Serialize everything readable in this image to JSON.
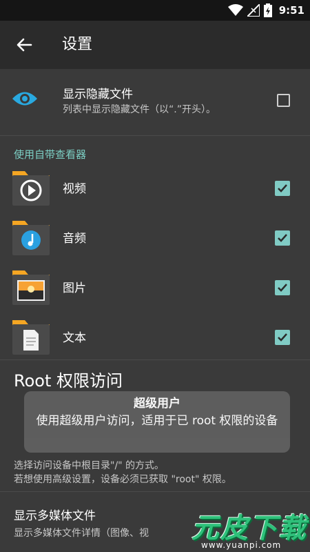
{
  "status_bar": {
    "time": "9:51",
    "icons": [
      "wifi-icon",
      "signal-icon",
      "battery-charging-icon"
    ]
  },
  "app_bar": {
    "title": "设置",
    "back_icon": "arrow-left-icon"
  },
  "show_hidden": {
    "title": "显示隐藏文件",
    "subtitle": "列表中显示隐藏文件（以“.”开头）。",
    "checked": false,
    "icon": "eye-icon"
  },
  "viewers": {
    "header": "使用自带查看器",
    "items": [
      {
        "label": "视频",
        "icon": "video-folder-icon",
        "checked": true
      },
      {
        "label": "音频",
        "icon": "audio-folder-icon",
        "checked": true
      },
      {
        "label": "图片",
        "icon": "image-folder-icon",
        "checked": true
      },
      {
        "label": "文本",
        "icon": "text-folder-icon",
        "checked": true
      }
    ]
  },
  "root_access": {
    "title": "Root 权限访问",
    "description_line1": "选择访问设备中根目录\"/\" 的方式。",
    "description_line2": "若想使用高级设置，设备必须已获取 \"root\" 权限。"
  },
  "tooltip": {
    "title": "超级用户",
    "body": "使用超级用户访问，适用于已 root 权限的设备"
  },
  "media_files": {
    "title": "显示多媒体文件",
    "subtitle": "显示多媒体文件详情（图像、视"
  },
  "watermark": {
    "text": "元皮下载",
    "url": "www.yuanpi.com"
  },
  "colors": {
    "accent": "#80cbc4",
    "section_header": "#7ccfc4",
    "folder": "#f5a623",
    "eye": "#29a9e0",
    "background": "#3a3a3a",
    "appbar": "#2b2b2b"
  }
}
